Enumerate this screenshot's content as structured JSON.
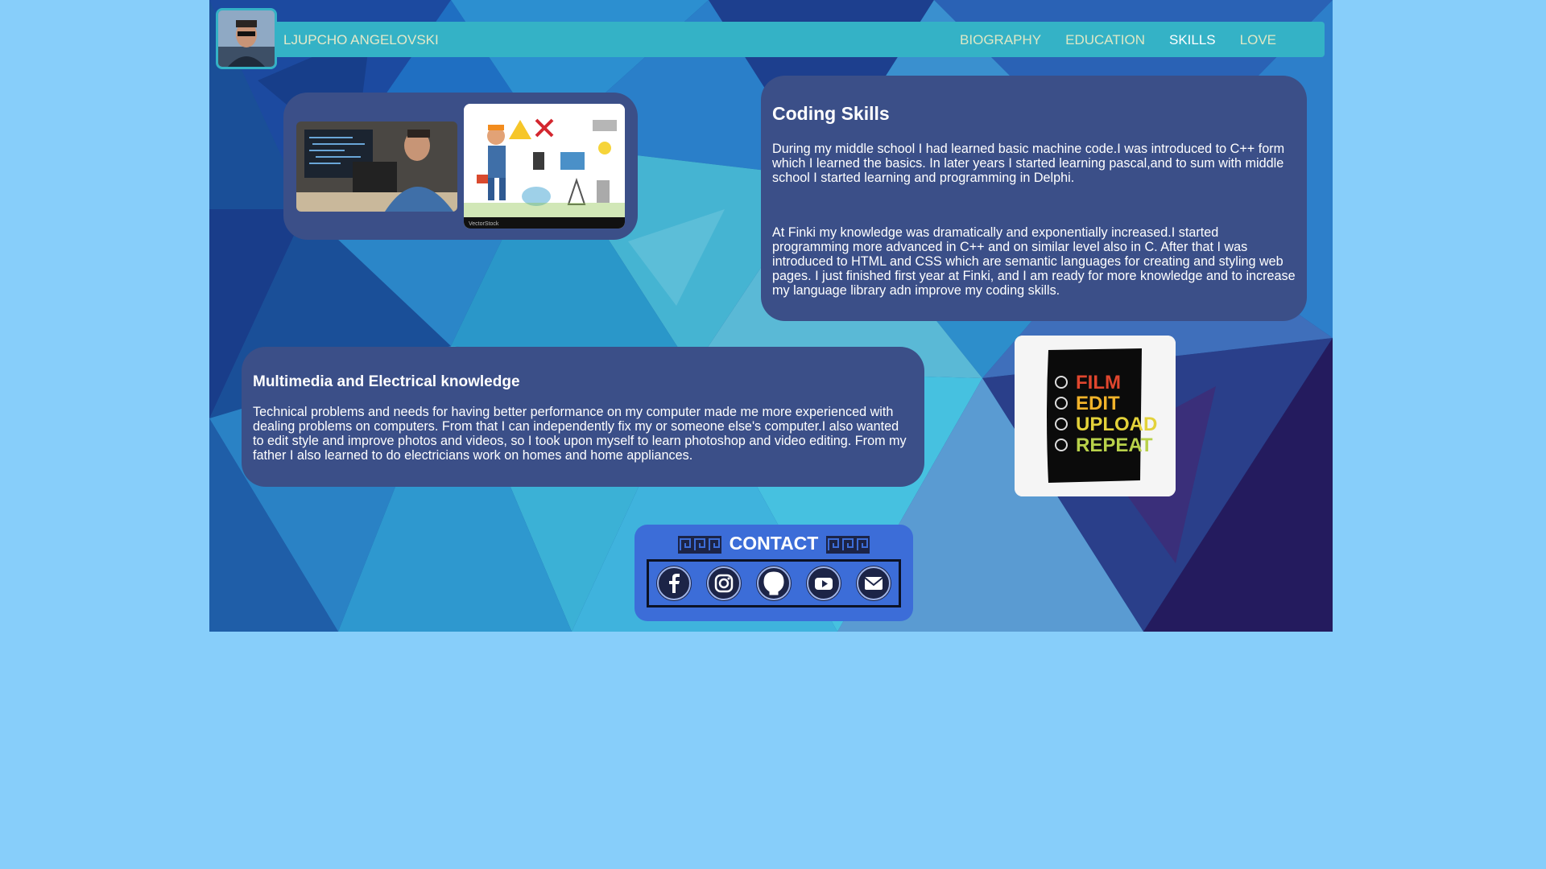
{
  "nav": {
    "brand": "LJUPCHO ANGELOVSKI",
    "items": [
      {
        "label": "BIOGRAPHY"
      },
      {
        "label": "EDUCATION"
      },
      {
        "label": "SKILLS",
        "active": true
      },
      {
        "label": "LOVE"
      }
    ]
  },
  "coding": {
    "title": "Coding Skills",
    "p1": "During my middle school I had learned basic machine code.I was introduced to C++ form which I learned the basics. In later years I started learning pascal,and to sum with middle school I started learning and programming in Delphi.",
    "p2": "At Finki my knowledge was dramatically and exponentially increased.I started programming more advanced in C++ and on similar level also in C. After that I was introduced to HTML and CSS which are semantic languages for creating and styling web pages. I just finished first year at Finki, and I am ready for more knowledge and to increase my language library adn improve my coding skills."
  },
  "multimedia": {
    "title": "Multimedia and Electrical knowledge",
    "p1": "Technical problems and needs for having better performance on my computer made me more experienced with dealing problems on computers. From that I can independently fix my or someone else's computer.I also wanted to edit style and improve photos and videos, so I took upon myself to learn photoshop and video editing. From my father I also learned to do electricians work on homes and home appliances."
  },
  "images": {
    "watermark": "VectorStock",
    "poster_words": [
      "FILM",
      "EDIT",
      "UPLOAD",
      "REPEAT"
    ]
  },
  "contact": {
    "title": "CONTACT",
    "icons": [
      "facebook-icon",
      "instagram-icon",
      "github-icon",
      "youtube-icon",
      "mail-icon"
    ]
  },
  "colors": {
    "page_bg": "#87cefa",
    "nav_bg": "#34b2c6",
    "card_bg": "#3b4f88",
    "contact_bg": "#3c6dd8"
  }
}
